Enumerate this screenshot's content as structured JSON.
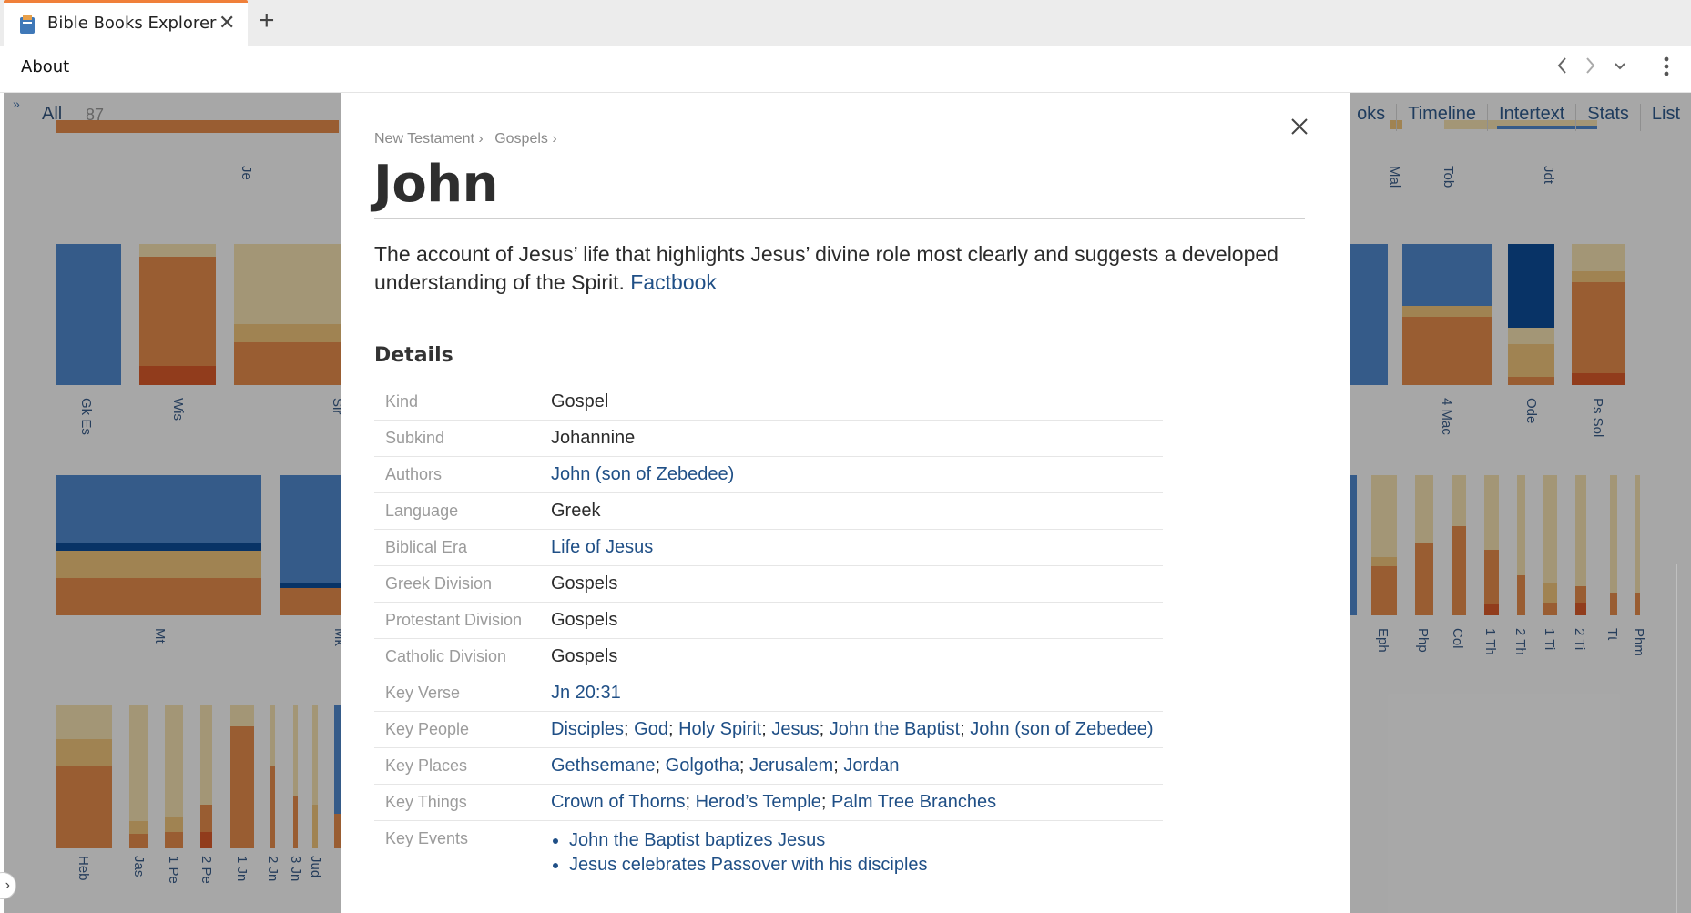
{
  "browser": {
    "tab_title": "Bible Books Explorer",
    "toolbar_link": "About"
  },
  "app": {
    "filter_all": "All",
    "filter_count": "87",
    "nav_tabs": [
      "oks",
      "Timeline",
      "Intertext",
      "Stats",
      "List"
    ],
    "colors": {
      "blue": "#4f88cc",
      "dark_blue": "#0d4c98",
      "orange": "#e58b4b",
      "light_orange": "#efc47b",
      "cream": "#f3e0b0",
      "rust": "#d85a2a"
    },
    "book_labels": [
      "Je",
      "Gk Es",
      "Wis",
      "Sir",
      "Mt",
      "Mk",
      "Heb",
      "Jas",
      "1 Pe",
      "2 Pe",
      "1 Jn",
      "2 Jn",
      "3 Jn",
      "Jud",
      "Mal",
      "Tob",
      "Jdt",
      "4 Mac",
      "Ode",
      "Ps Sol",
      "Eph",
      "Php",
      "Col",
      "1 Th",
      "2 Th",
      "1 Ti",
      "2 Ti",
      "Tt",
      "Phm"
    ]
  },
  "modal": {
    "breadcrumb": [
      "New Testament ›",
      "Gospels ›"
    ],
    "title": "John",
    "summary_text": "The account of Jesus’ life that highlights Jesus’ divine role most clearly and suggests a developed understanding of the Spirit.",
    "summary_link": "Factbook",
    "details_heading": "Details",
    "details": {
      "kind": {
        "label": "Kind",
        "value": "Gospel"
      },
      "subkind": {
        "label": "Subkind",
        "value": "Johannine"
      },
      "authors": {
        "label": "Authors",
        "value": "John (son of Zebedee)"
      },
      "language": {
        "label": "Language",
        "value": "Greek"
      },
      "biblical_era": {
        "label": "Biblical Era",
        "value": "Life of Jesus"
      },
      "greek_division": {
        "label": "Greek Division",
        "value": "Gospels"
      },
      "protestant_division": {
        "label": "Protestant Division",
        "value": "Gospels"
      },
      "catholic_division": {
        "label": "Catholic Division",
        "value": "Gospels"
      },
      "key_verse": {
        "label": "Key Verse",
        "value": "Jn 20:31"
      },
      "key_people": {
        "label": "Key People",
        "items": [
          "Disciples",
          "God",
          "Holy Spirit",
          "Jesus",
          "John the Baptist",
          "John (son of Zebedee)"
        ]
      },
      "key_places": {
        "label": "Key Places",
        "items": [
          "Gethsemane",
          "Golgotha",
          "Jerusalem",
          "Jordan"
        ]
      },
      "key_things": {
        "label": "Key Things",
        "items": [
          "Crown of Thorns",
          "Herod’s Temple",
          "Palm Tree Branches"
        ]
      },
      "key_events": {
        "label": "Key Events",
        "items": [
          "John the Baptist baptizes Jesus",
          "Jesus celebrates Passover with his disciples"
        ]
      }
    }
  }
}
